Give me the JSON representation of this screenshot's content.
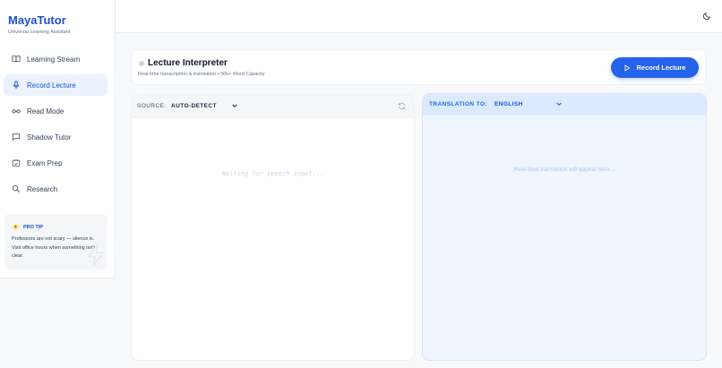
{
  "app": {
    "name": "MayaTutor",
    "tagline": "Universal Learning Assistant"
  },
  "sidebar": {
    "items": [
      {
        "label": "Learning Stream",
        "icon": "book-open-icon",
        "active": false
      },
      {
        "label": "Record Lecture",
        "icon": "microphone-icon",
        "active": true
      },
      {
        "label": "Read Mode",
        "icon": "glasses-icon",
        "active": false
      },
      {
        "label": "Shadow Tutor",
        "icon": "chat-bubble-icon",
        "active": false
      },
      {
        "label": "Exam Prep",
        "icon": "calendar-check-icon",
        "active": false
      },
      {
        "label": "Research",
        "icon": "search-icon",
        "active": false
      }
    ],
    "tip": {
      "heading": "PRO TIP",
      "text": "Professors are not scary — silence is. Visit office hours when something isn't clear."
    }
  },
  "topbar": {
    "theme_icon": "moon-icon"
  },
  "header": {
    "title": "Lecture Interpreter",
    "subtitle": "Real-time transcription & translation • 50k+ Word Capacity",
    "record_label": "Record Lecture",
    "record_icon": "play-outline-icon"
  },
  "source_panel": {
    "label": "SOURCE:",
    "value": "AUTO-DETECT",
    "placeholder": "Waiting for speech input..."
  },
  "translation_panel": {
    "label": "TRANSLATION TO:",
    "value": "ENGLISH",
    "placeholder": "Real-time translation will appear here..."
  },
  "colors": {
    "accent": "#2563eb",
    "active_nav_bg": "#eaf2fe",
    "translation_bg": "#f0f6fe",
    "translation_header_bg": "#dbeafe"
  }
}
